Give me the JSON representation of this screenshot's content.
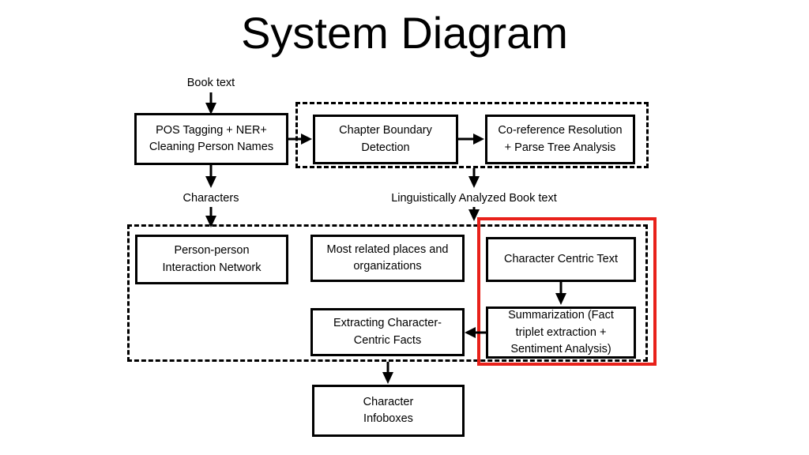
{
  "page": {
    "title": "System Diagram",
    "background_color": "#ffffff",
    "highlight_color": "#e8211a"
  },
  "diagram": {
    "type": "flowchart",
    "nodes": [
      {
        "id": "pos_tagging",
        "label": "POS Tagging + NER+ Cleaning Person Names",
        "line1": "POS Tagging + NER+",
        "line2": "Cleaning Person Names"
      },
      {
        "id": "chapter_boundary",
        "label": "Chapter Boundary Detection",
        "line1": "Chapter Boundary",
        "line2": "Detection"
      },
      {
        "id": "coref",
        "label": "Co-reference Resolution + Parse Tree Analysis",
        "line1": "Co-reference Resolution",
        "line2": "+ Parse Tree Analysis"
      },
      {
        "id": "interaction_network",
        "label": "Person-person Interaction Network",
        "line1": "Person-person",
        "line2": "Interaction Network"
      },
      {
        "id": "places_orgs",
        "label": "Most related places and organizations",
        "line1": "Most related places and",
        "line2": "organizations"
      },
      {
        "id": "char_centric_text",
        "label": "Character Centric Text",
        "line1": "Character Centric Text",
        "line2": ""
      },
      {
        "id": "extracting_facts",
        "label": "Extracting Character-Centric Facts",
        "line1": "Extracting Character-",
        "line2": "Centric Facts"
      },
      {
        "id": "summarization",
        "label": "Summarization (Fact triplet extraction + Sentiment Analysis)",
        "line1": "Summarization (Fact",
        "line2": "triplet extraction +",
        "line3": "Sentiment Analysis)"
      },
      {
        "id": "char_infoboxes",
        "label": "Character Infoboxes",
        "line1": "Character",
        "line2": "Infoboxes"
      }
    ],
    "edge_labels": [
      {
        "id": "book_text",
        "text": "Book text"
      },
      {
        "id": "characters",
        "text": "Characters"
      },
      {
        "id": "linguistically_analyzed",
        "text": "Linguistically Analyzed Book text"
      }
    ],
    "groups": [
      {
        "id": "nlp_pipeline_group",
        "style": "dashed",
        "label": ""
      },
      {
        "id": "analysis_group",
        "style": "dashed",
        "label": ""
      },
      {
        "id": "highlighted_group",
        "style": "red",
        "label": ""
      }
    ]
  }
}
